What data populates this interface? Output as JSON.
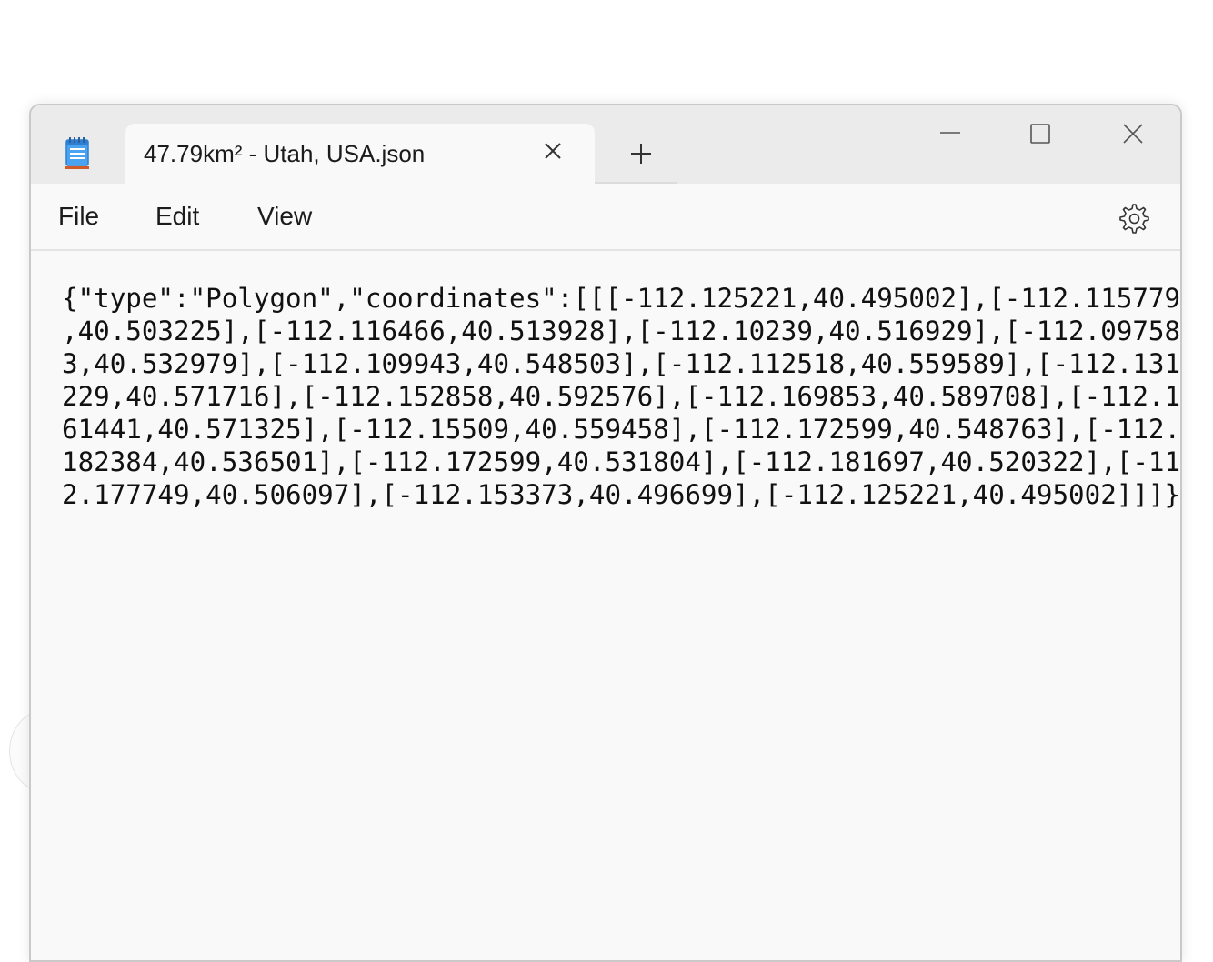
{
  "tab": {
    "title": "47.79km² - Utah, USA.json"
  },
  "menu": {
    "file": "File",
    "edit": "Edit",
    "view": "View"
  },
  "editor": {
    "lines": [
      "{\"type\":\"Polygon\",\"coordinates\":[[[-112.125221,40.495002],[-112.115779",
      ",40.503225],[-112.116466,40.513928],[-112.10239,40.516929],[-112.09758",
      "3,40.532979],[-112.109943,40.548503],[-112.112518,40.559589],[-112.131",
      "229,40.571716],[-112.152858,40.592576],[-112.169853,40.589708],[-112.1",
      "61441,40.571325],[-112.15509,40.559458],[-112.172599,40.548763],[-112.",
      "182384,40.536501],[-112.172599,40.531804],[-112.181697,40.520322],[-11",
      "2.177749,40.506097],[-112.153373,40.496699],[-112.125221,40.495002]]]}"
    ]
  },
  "icons": {
    "app": "notepad-icon",
    "tab_close": "close-icon",
    "new_tab": "plus-icon",
    "minimize": "minimize-icon",
    "maximize": "maximize-icon",
    "close": "close-icon",
    "settings": "gear-icon"
  },
  "colors": {
    "notepad_blue": "#3a8ee6",
    "notepad_orange": "#d25b2a"
  }
}
